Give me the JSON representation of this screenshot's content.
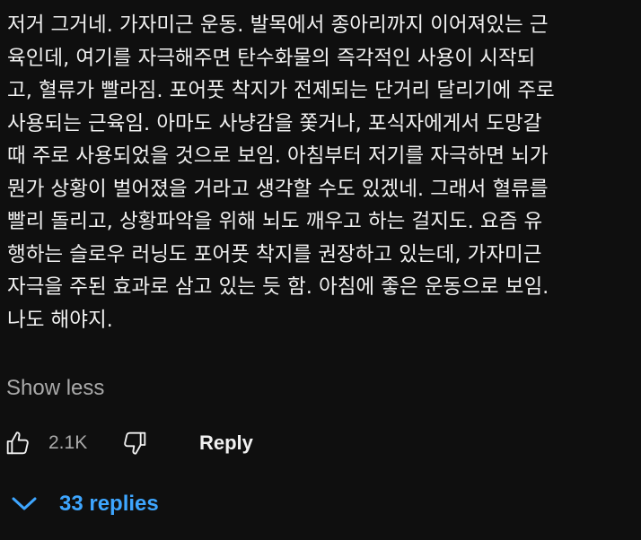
{
  "comment": {
    "lines": [
      "저거 그거네. 가자미근 운동. 발목에서 종아리까지 이어져있는 근",
      "육인데, 여기를 자극해주면 탄수화물의 즉각적인 사용이 시작되",
      "고, 혈류가 빨라짐. 포어풋 착지가 전제되는 단거리 달리기에 주로",
      "사용되는 근육임. 아마도 사냥감을 쫓거나, 포식자에게서 도망갈",
      "때 주로 사용되었을 것으로 보임. 아침부터 저기를 자극하면 뇌가",
      "뭔가 상황이 벌어졌을 거라고 생각할 수도 있겠네. 그래서 혈류를",
      "빨리 돌리고, 상황파악을 위해 뇌도 깨우고 하는 걸지도. 요즘 유",
      "행하는 슬로우 러닝도 포어풋 착지를 권장하고 있는데, 가자미근",
      "자극을 주된 효과로 삼고 있는 듯 함. 아침에 좋은 운동으로 보임.",
      "나도 해야지."
    ],
    "show_less_label": "Show less"
  },
  "actions": {
    "like_icon": "thumbs-up-icon",
    "like_count": "2.1K",
    "dislike_icon": "thumbs-down-icon",
    "reply_label": "Reply"
  },
  "replies": {
    "toggle_icon": "chevron-down-icon",
    "label": "33 replies"
  },
  "colors": {
    "background": "#0f0f0f",
    "text": "#f1f1f1",
    "secondary_text": "#aaaaaa",
    "link_blue": "#3ea6ff"
  }
}
